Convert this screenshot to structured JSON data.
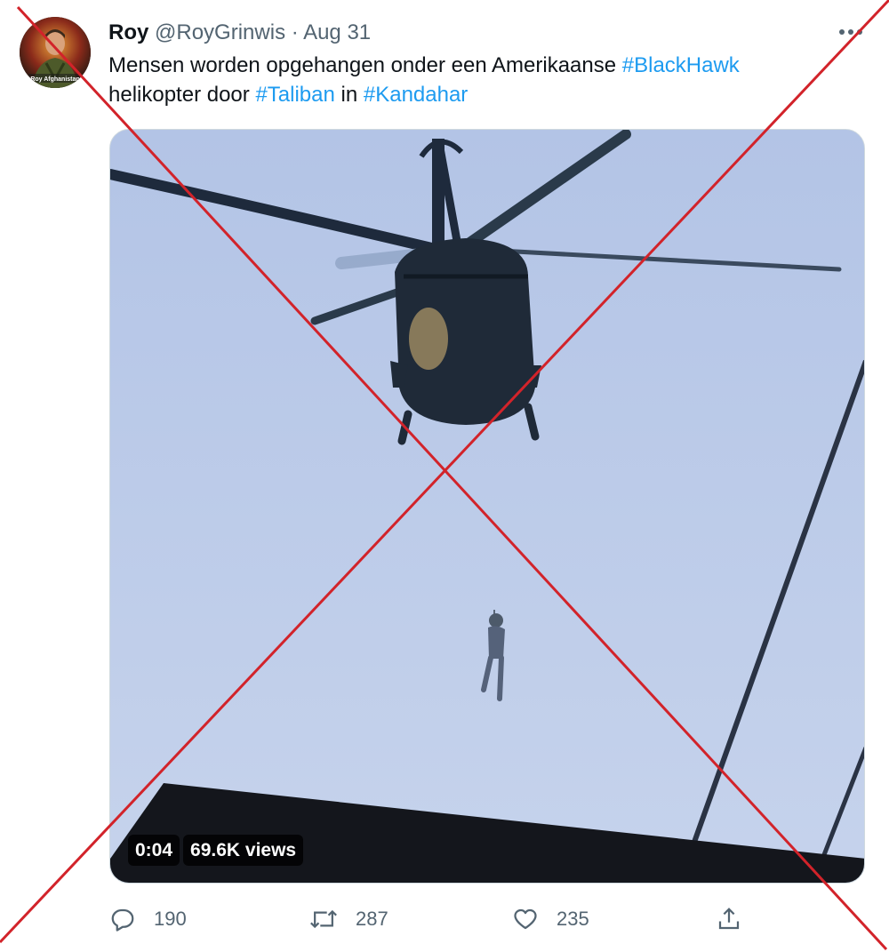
{
  "tweet": {
    "display_name": "Roy",
    "handle": "@RoyGrinwis",
    "separator": "·",
    "date": "Aug 31",
    "more_icon": "more-horizontal-icon",
    "text_part1": "Mensen worden opgehangen onder een Amerikaanse ",
    "hashtag1": "#BlackHawk",
    "text_part2": "helikopter door ",
    "hashtag2": "#Taliban",
    "text_part3": " in ",
    "hashtag3": "#Kandahar",
    "avatar_caption": "Roy Afghanistan"
  },
  "media": {
    "duration": "0:04",
    "views": "69.6K views"
  },
  "actions": {
    "replies": "190",
    "retweets": "287",
    "likes": "235",
    "reply_icon": "reply-icon",
    "retweet_icon": "retweet-icon",
    "like_icon": "heart-icon",
    "share_icon": "share-icon"
  },
  "colors": {
    "link": "#1d9bf0",
    "muted": "#536471",
    "cross": "#d2232a"
  }
}
